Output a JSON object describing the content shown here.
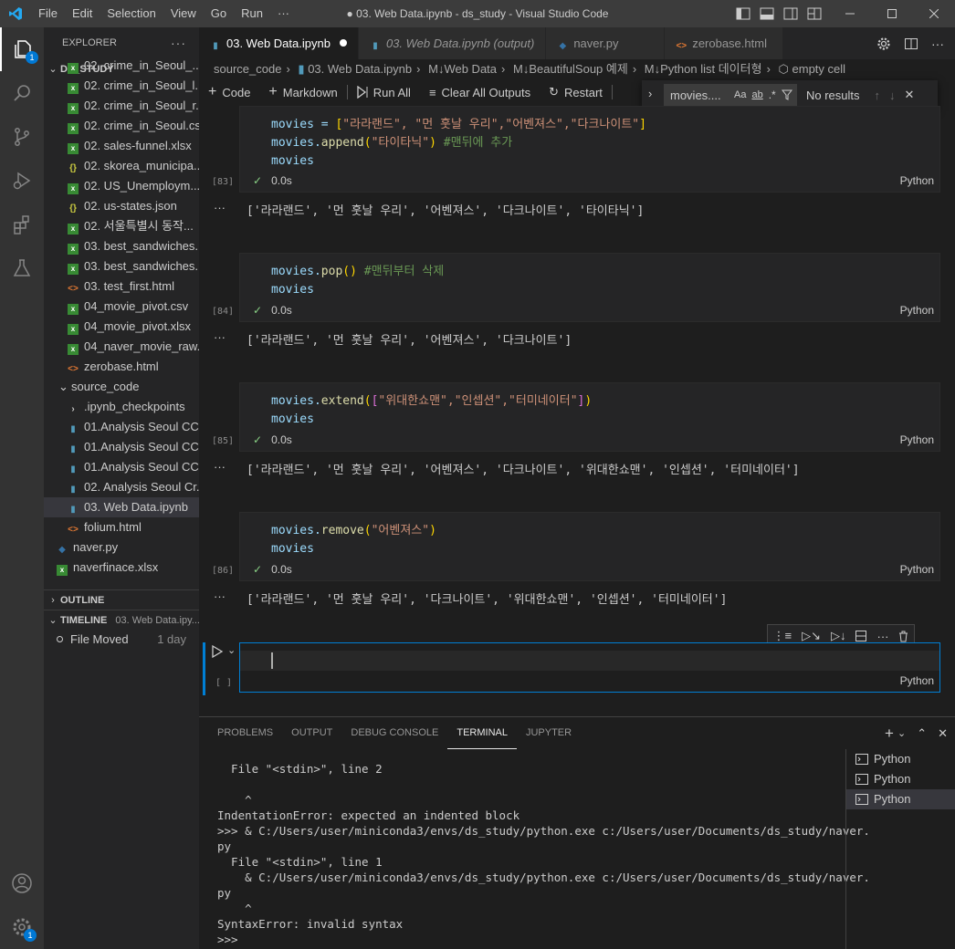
{
  "titlebar": {
    "menu": [
      "File",
      "Edit",
      "Selection",
      "View",
      "Go",
      "Run",
      "···"
    ],
    "title": "● 03. Web Data.ipynb - ds_study - Visual Studio Code"
  },
  "activity": {
    "explorer_badge": "1",
    "settings_badge": "1"
  },
  "sidebar": {
    "header": "EXPLORER",
    "folder": "DS_STUDY",
    "files": [
      {
        "name": "02. crime_in_Seoul_...",
        "icon": "excel"
      },
      {
        "name": "02. crime_in_Seoul_l...",
        "icon": "excel"
      },
      {
        "name": "02. crime_in_Seoul_r...",
        "icon": "excel"
      },
      {
        "name": "02. crime_in_Seoul.csv",
        "icon": "excel"
      },
      {
        "name": "02. sales-funnel.xlsx",
        "icon": "excel"
      },
      {
        "name": "02. skorea_municipa...",
        "icon": "json"
      },
      {
        "name": "02. US_Unemploym...",
        "icon": "excel"
      },
      {
        "name": "02. us-states.json",
        "icon": "json"
      },
      {
        "name": "02. 서울특별시 동작...",
        "icon": "excel"
      },
      {
        "name": "03. best_sandwiches...",
        "icon": "excel"
      },
      {
        "name": "03. best_sandwiches...",
        "icon": "excel"
      },
      {
        "name": "03. test_first.html",
        "icon": "html"
      },
      {
        "name": "04_movie_pivot.csv",
        "icon": "excel"
      },
      {
        "name": "04_movie_pivot.xlsx",
        "icon": "excel"
      },
      {
        "name": "04_naver_movie_raw...",
        "icon": "excel"
      },
      {
        "name": "zerobase.html",
        "icon": "html"
      }
    ],
    "subfolder": "source_code",
    "subfiles": [
      {
        "name": ".ipynb_checkpoints",
        "icon": "folder"
      },
      {
        "name": "01.Analysis Seoul CC...",
        "icon": "notebook"
      },
      {
        "name": "01.Analysis Seoul CC...",
        "icon": "notebook"
      },
      {
        "name": "01.Analysis Seoul CC...",
        "icon": "notebook"
      },
      {
        "name": "02. Analysis Seoul Cr...",
        "icon": "notebook"
      },
      {
        "name": "03. Web Data.ipynb",
        "icon": "notebook"
      },
      {
        "name": "folium.html",
        "icon": "html"
      }
    ],
    "rootfiles": [
      {
        "name": "naver.py",
        "icon": "python"
      },
      {
        "name": "naverfinace.xlsx",
        "icon": "excel"
      }
    ],
    "outline": "OUTLINE",
    "timeline": "TIMELINE",
    "timeline_file": "03. Web Data.ipy...",
    "timeline_entry": "File Moved",
    "timeline_when": "1 day"
  },
  "tabs": [
    {
      "label": "03. Web Data.ipynb",
      "active": true,
      "dirty": true
    },
    {
      "label": "03. Web Data.ipynb (output)",
      "active": false
    },
    {
      "label": "naver.py",
      "active": false
    },
    {
      "label": "zerobase.html",
      "active": false
    }
  ],
  "breadcrumb": [
    "source_code",
    "03. Web Data.ipynb",
    "M↓Web Data",
    "M↓BeautifulSoup 예제",
    "M↓Python list 데이터형",
    "empty cell"
  ],
  "toolbar": {
    "code": "Code",
    "markdown": "Markdown",
    "run_all": "Run All",
    "clear": "Clear All Outputs",
    "restart": "Restart"
  },
  "find": {
    "query": "movies....",
    "results": "No results"
  },
  "cells": [
    {
      "exec": "[83]",
      "time": "0.0s",
      "lang": "Python",
      "output": "['라라랜드', '먼 훗날 우리', '어벤져스', '다크나이트', '타이타닉']"
    },
    {
      "exec": "[84]",
      "time": "0.0s",
      "lang": "Python",
      "output": "['라라랜드', '먼 훗날 우리', '어벤져스', '다크나이트']"
    },
    {
      "exec": "[85]",
      "time": "0.0s",
      "lang": "Python",
      "output": "['라라랜드', '먼 훗날 우리', '어벤져스', '다크나이트', '위대한쇼맨', '인셉션', '터미네이터']"
    },
    {
      "exec": "[86]",
      "time": "0.0s",
      "lang": "Python",
      "output": "['라라랜드', '먼 훗날 우리', '다크나이트', '위대한쇼맨', '인셉션', '터미네이터']"
    }
  ],
  "code": {
    "c1l1a": "movies = ",
    "c1l1b": "[",
    "c1l1c": "\"라라랜드\", \"먼 훗날 우리\",\"어벤져스\",\"다크나이트\"",
    "c1l1d": "]",
    "c1l2a": "movies.",
    "c1l2b": "append",
    "c1l2c": "(",
    "c1l2d": "\"타이타닉\"",
    "c1l2e": ") ",
    "c1l2f": "#맨뒤에 추가",
    "c1l3": "movies",
    "c2l1a": "movies.",
    "c2l1b": "pop",
    "c2l1c": "() ",
    "c2l1d": "#맨뒤부터 삭제",
    "c2l2": "movies",
    "c3l1a": "movies.",
    "c3l1b": "extend",
    "c3l1c": "(",
    "c3l1d": "[",
    "c3l1e": "\"위대한쇼맨\",\"인셉션\",\"터미네이터\"",
    "c3l1f": "]",
    "c3l1g": ")",
    "c3l2": "movies",
    "c4l1a": "movies.",
    "c4l1b": "remove",
    "c4l1c": "(",
    "c4l1d": "\"어벤져스\"",
    "c4l1e": ")",
    "c4l2": "movies"
  },
  "empty_cell": {
    "exec": "[ ]",
    "lang": "Python"
  },
  "panel": {
    "tabs": [
      "PROBLEMS",
      "OUTPUT",
      "DEBUG CONSOLE",
      "TERMINAL",
      "JUPYTER"
    ],
    "active_tab": "TERMINAL",
    "terminal_lines": [
      "  File \"<stdin>\", line 2",
      "",
      "    ^",
      "IndentationError: expected an indented block",
      ">>> & C:/Users/user/miniconda3/envs/ds_study/python.exe c:/Users/user/Documents/ds_study/naver.",
      "py",
      "  File \"<stdin>\", line 1",
      "    & C:/Users/user/miniconda3/envs/ds_study/python.exe c:/Users/user/Documents/ds_study/naver.",
      "py",
      "    ^",
      "SyntaxError: invalid syntax",
      ">>>"
    ],
    "terminals": [
      "Python",
      "Python",
      "Python"
    ]
  },
  "colors": {
    "accent": "#0078d4",
    "check": "#89d185",
    "cell_focus": "#007fd4"
  }
}
